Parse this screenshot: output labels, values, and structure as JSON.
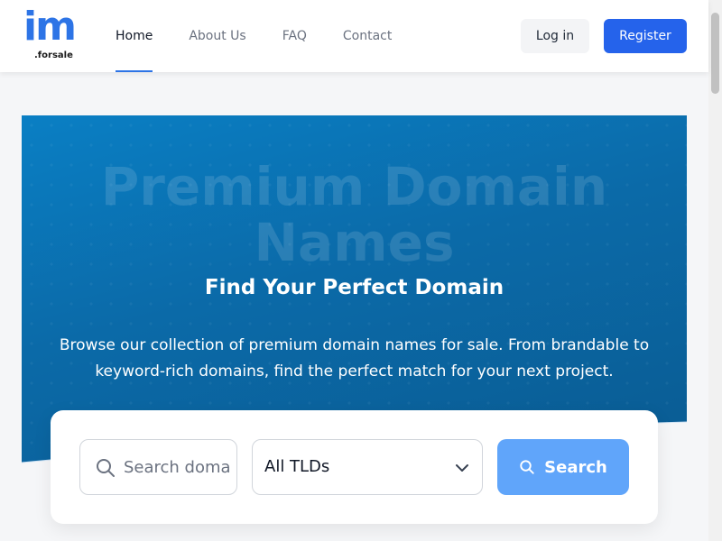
{
  "header": {
    "logo_mark": "im",
    "logo_sub": ".forsale",
    "nav": [
      {
        "label": "Home",
        "active": true
      },
      {
        "label": "About Us",
        "active": false
      },
      {
        "label": "FAQ",
        "active": false
      },
      {
        "label": "Contact",
        "active": false
      }
    ],
    "login_label": "Log in",
    "register_label": "Register"
  },
  "hero": {
    "background_title": "Premium Domain Names",
    "subtitle": "Find Your Perfect Domain",
    "description": "Browse our collection of premium domain names for sale. From brandable to keyword-rich domains, find the perfect match for your next project."
  },
  "search": {
    "placeholder": "Search domains...",
    "tld_selected": "All TLDs",
    "button_label": "Search",
    "icons": {
      "input": "search-icon",
      "select": "chevron-down-icon",
      "button": "search-icon"
    }
  },
  "colors": {
    "brand": "#2d74e6",
    "register_bg": "#2563eb",
    "hero_bg": "#0b6aa8",
    "search_button": "#60a5fa"
  }
}
